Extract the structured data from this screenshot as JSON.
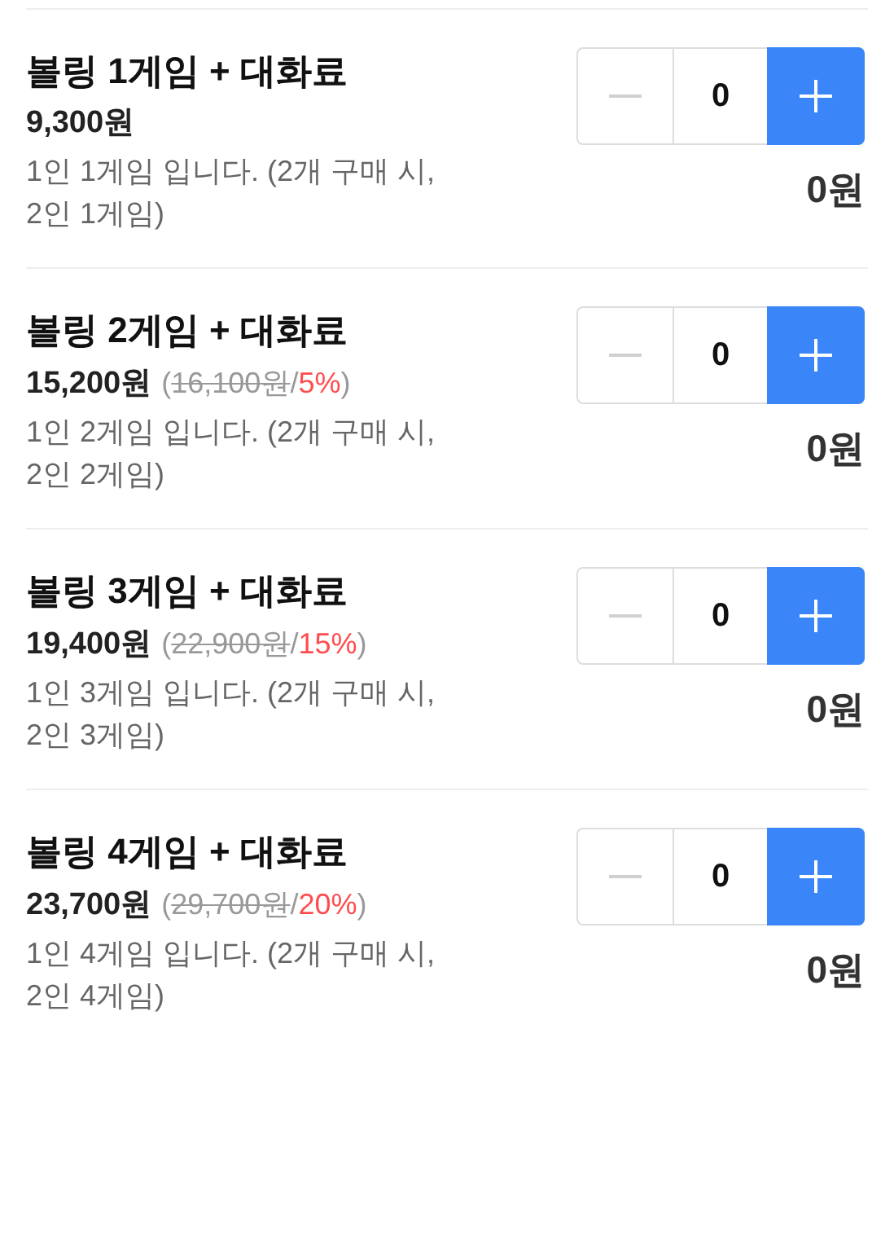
{
  "items": [
    {
      "title": "볼링 1게임 + 대화료",
      "price": "9,300원",
      "description": "1인 1게임 입니다. (2개 구매 시, 2인 1게임)",
      "quantity": "0",
      "minus_disabled": true,
      "total": "0원"
    },
    {
      "title": "볼링 2게임 + 대화료",
      "price": "15,200원",
      "compare": [
        {
          "kind": "plain",
          "text": "("
        },
        {
          "kind": "struck",
          "text": "16,100원"
        },
        {
          "kind": "plain",
          "text": "/"
        },
        {
          "kind": "discount",
          "text": "5%"
        },
        {
          "kind": "plain",
          "text": ")"
        }
      ],
      "description": "1인 2게임 입니다. (2개 구매 시, 2인 2게임)",
      "quantity": "0",
      "minus_disabled": true,
      "total": "0원"
    },
    {
      "title": "볼링 3게임 + 대화료",
      "price": "19,400원",
      "compare": [
        {
          "kind": "plain",
          "text": "("
        },
        {
          "kind": "struck",
          "text": "22,900원"
        },
        {
          "kind": "plain",
          "text": "/"
        },
        {
          "kind": "discount",
          "text": "15%"
        },
        {
          "kind": "plain",
          "text": ")"
        }
      ],
      "description": "1인 3게임 입니다. (2개 구매 시, 2인 3게임)",
      "quantity": "0",
      "minus_disabled": true,
      "total": "0원"
    },
    {
      "title": "볼링 4게임 + 대화료",
      "price": "23,700원",
      "compare": [
        {
          "kind": "plain",
          "text": "("
        },
        {
          "kind": "struck",
          "text": "29,700원"
        },
        {
          "kind": "plain",
          "text": "/"
        },
        {
          "kind": "discount",
          "text": "20%"
        },
        {
          "kind": "plain",
          "text": ")"
        }
      ],
      "description": "1인 4게임 입니다. (2개 구매 시, 2인 4게임)",
      "quantity": "0",
      "minus_disabled": true,
      "total": "0원"
    }
  ]
}
